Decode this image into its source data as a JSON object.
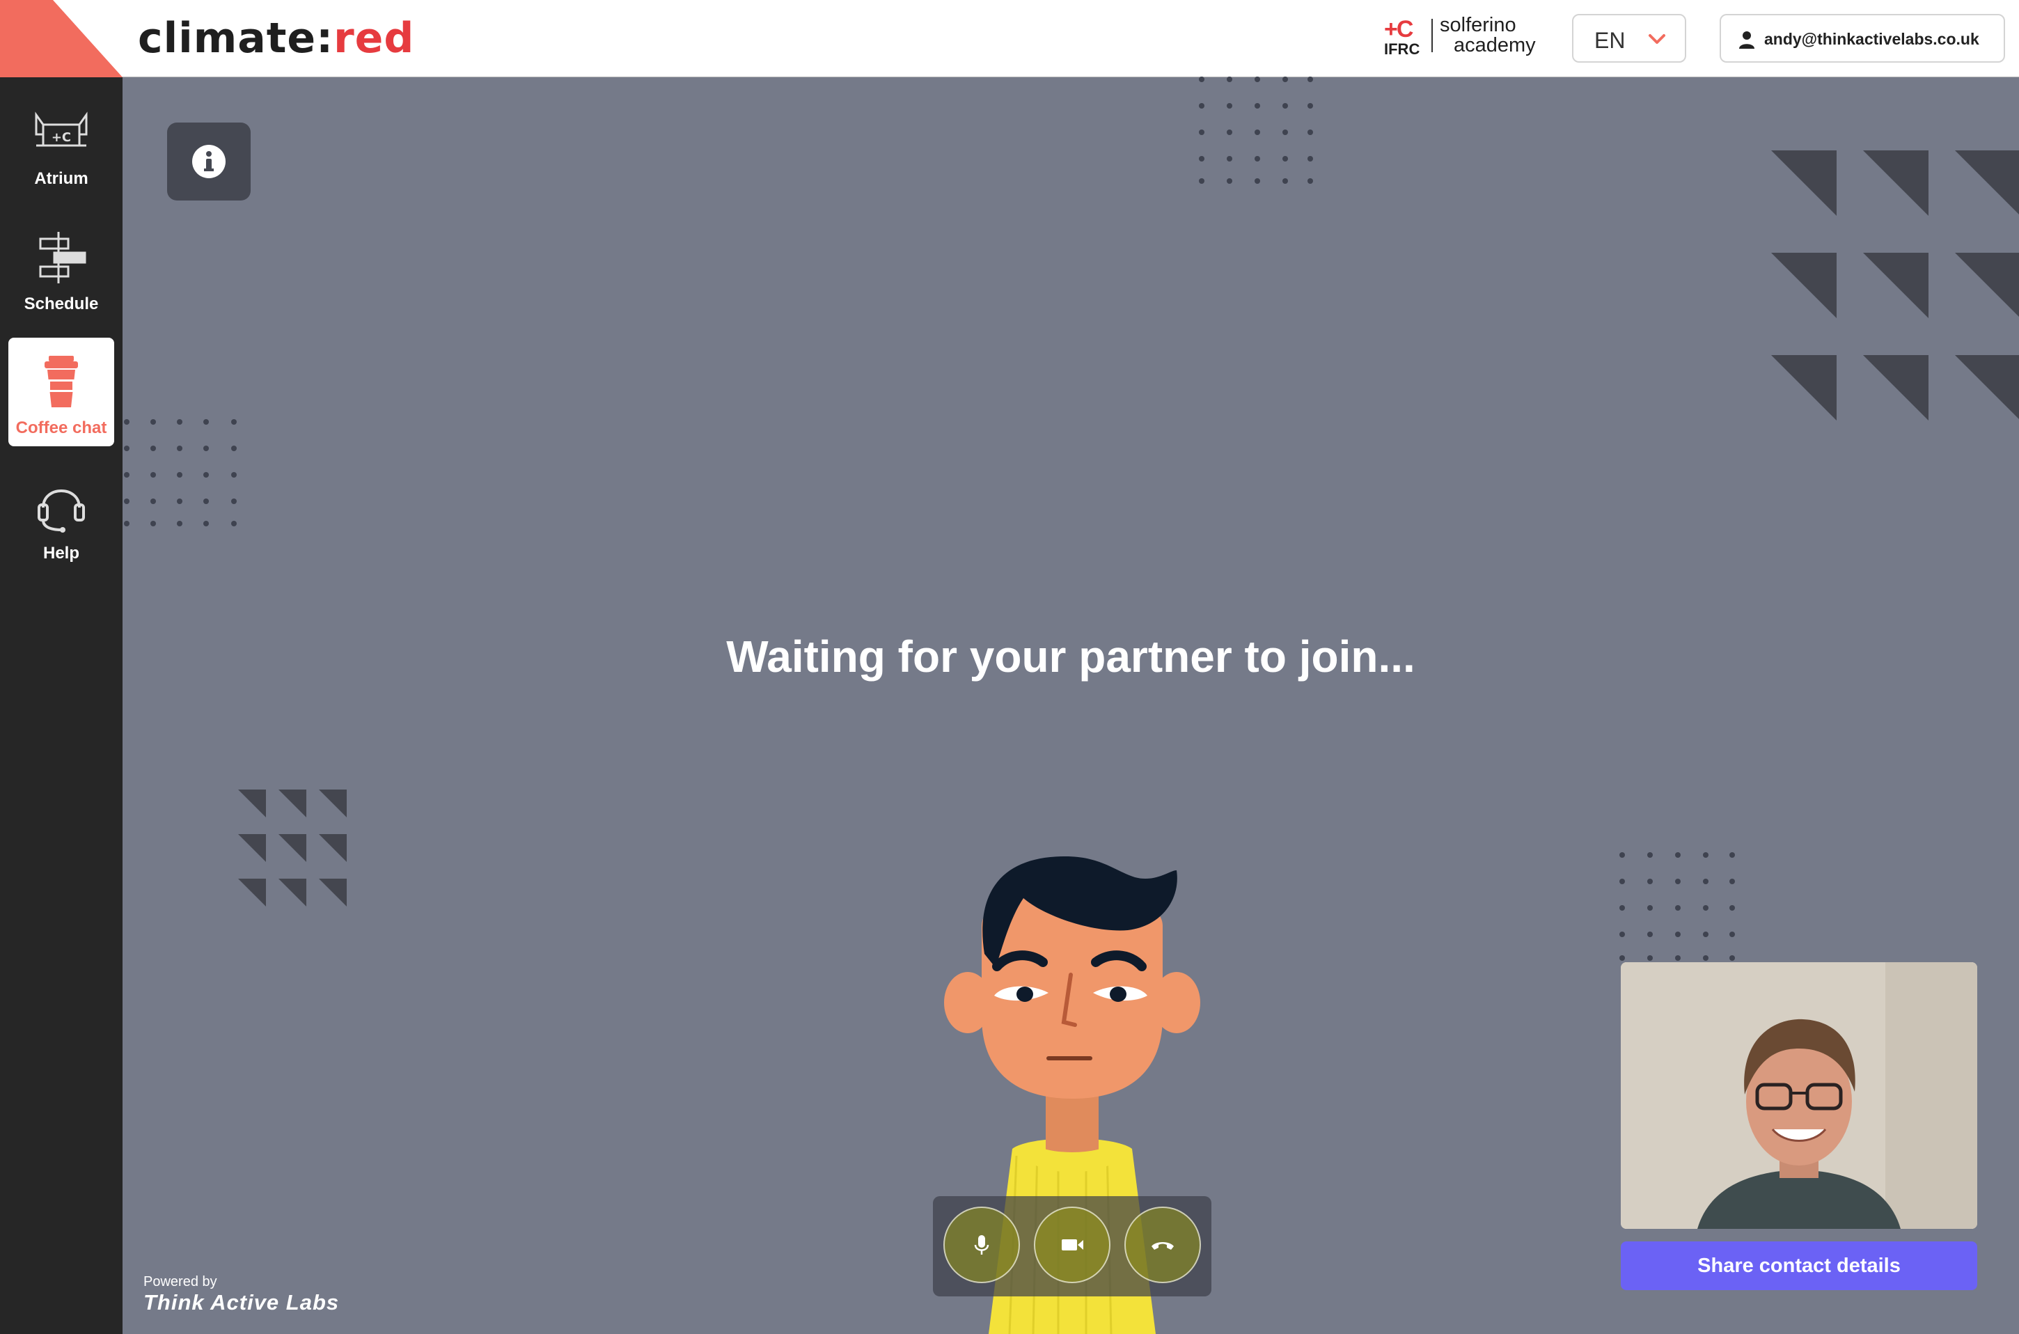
{
  "header": {
    "brand_prefix": "climate:",
    "brand_suffix": "red",
    "partner_emblem": "+C",
    "partner_abbr": "IFRC",
    "partner_line1": "solferino",
    "partner_line2": "academy",
    "language": "EN",
    "account_email": "andy@thinkactivelabs.co.uk"
  },
  "sidebar": {
    "items": [
      {
        "label": "Atrium",
        "icon": "atrium-icon",
        "active": false
      },
      {
        "label": "Schedule",
        "icon": "signpost-icon",
        "active": false
      },
      {
        "label": "Coffee chat",
        "icon": "coffee-cup-icon",
        "active": true
      },
      {
        "label": "Help",
        "icon": "headset-icon",
        "active": false
      }
    ],
    "powered_by": "Powered by",
    "powered_by_brand": "Think Active Labs"
  },
  "main": {
    "status_message": "Waiting for your partner to join...",
    "controls": [
      "microphone-icon",
      "video-camera-icon",
      "hang-up-icon"
    ],
    "share_button": "Share contact details"
  },
  "colors": {
    "accent": "#e63b3f",
    "corner": "#f26c5e",
    "background": "#757a89",
    "sidebar": "#262626",
    "share_button": "#6b62f5"
  }
}
